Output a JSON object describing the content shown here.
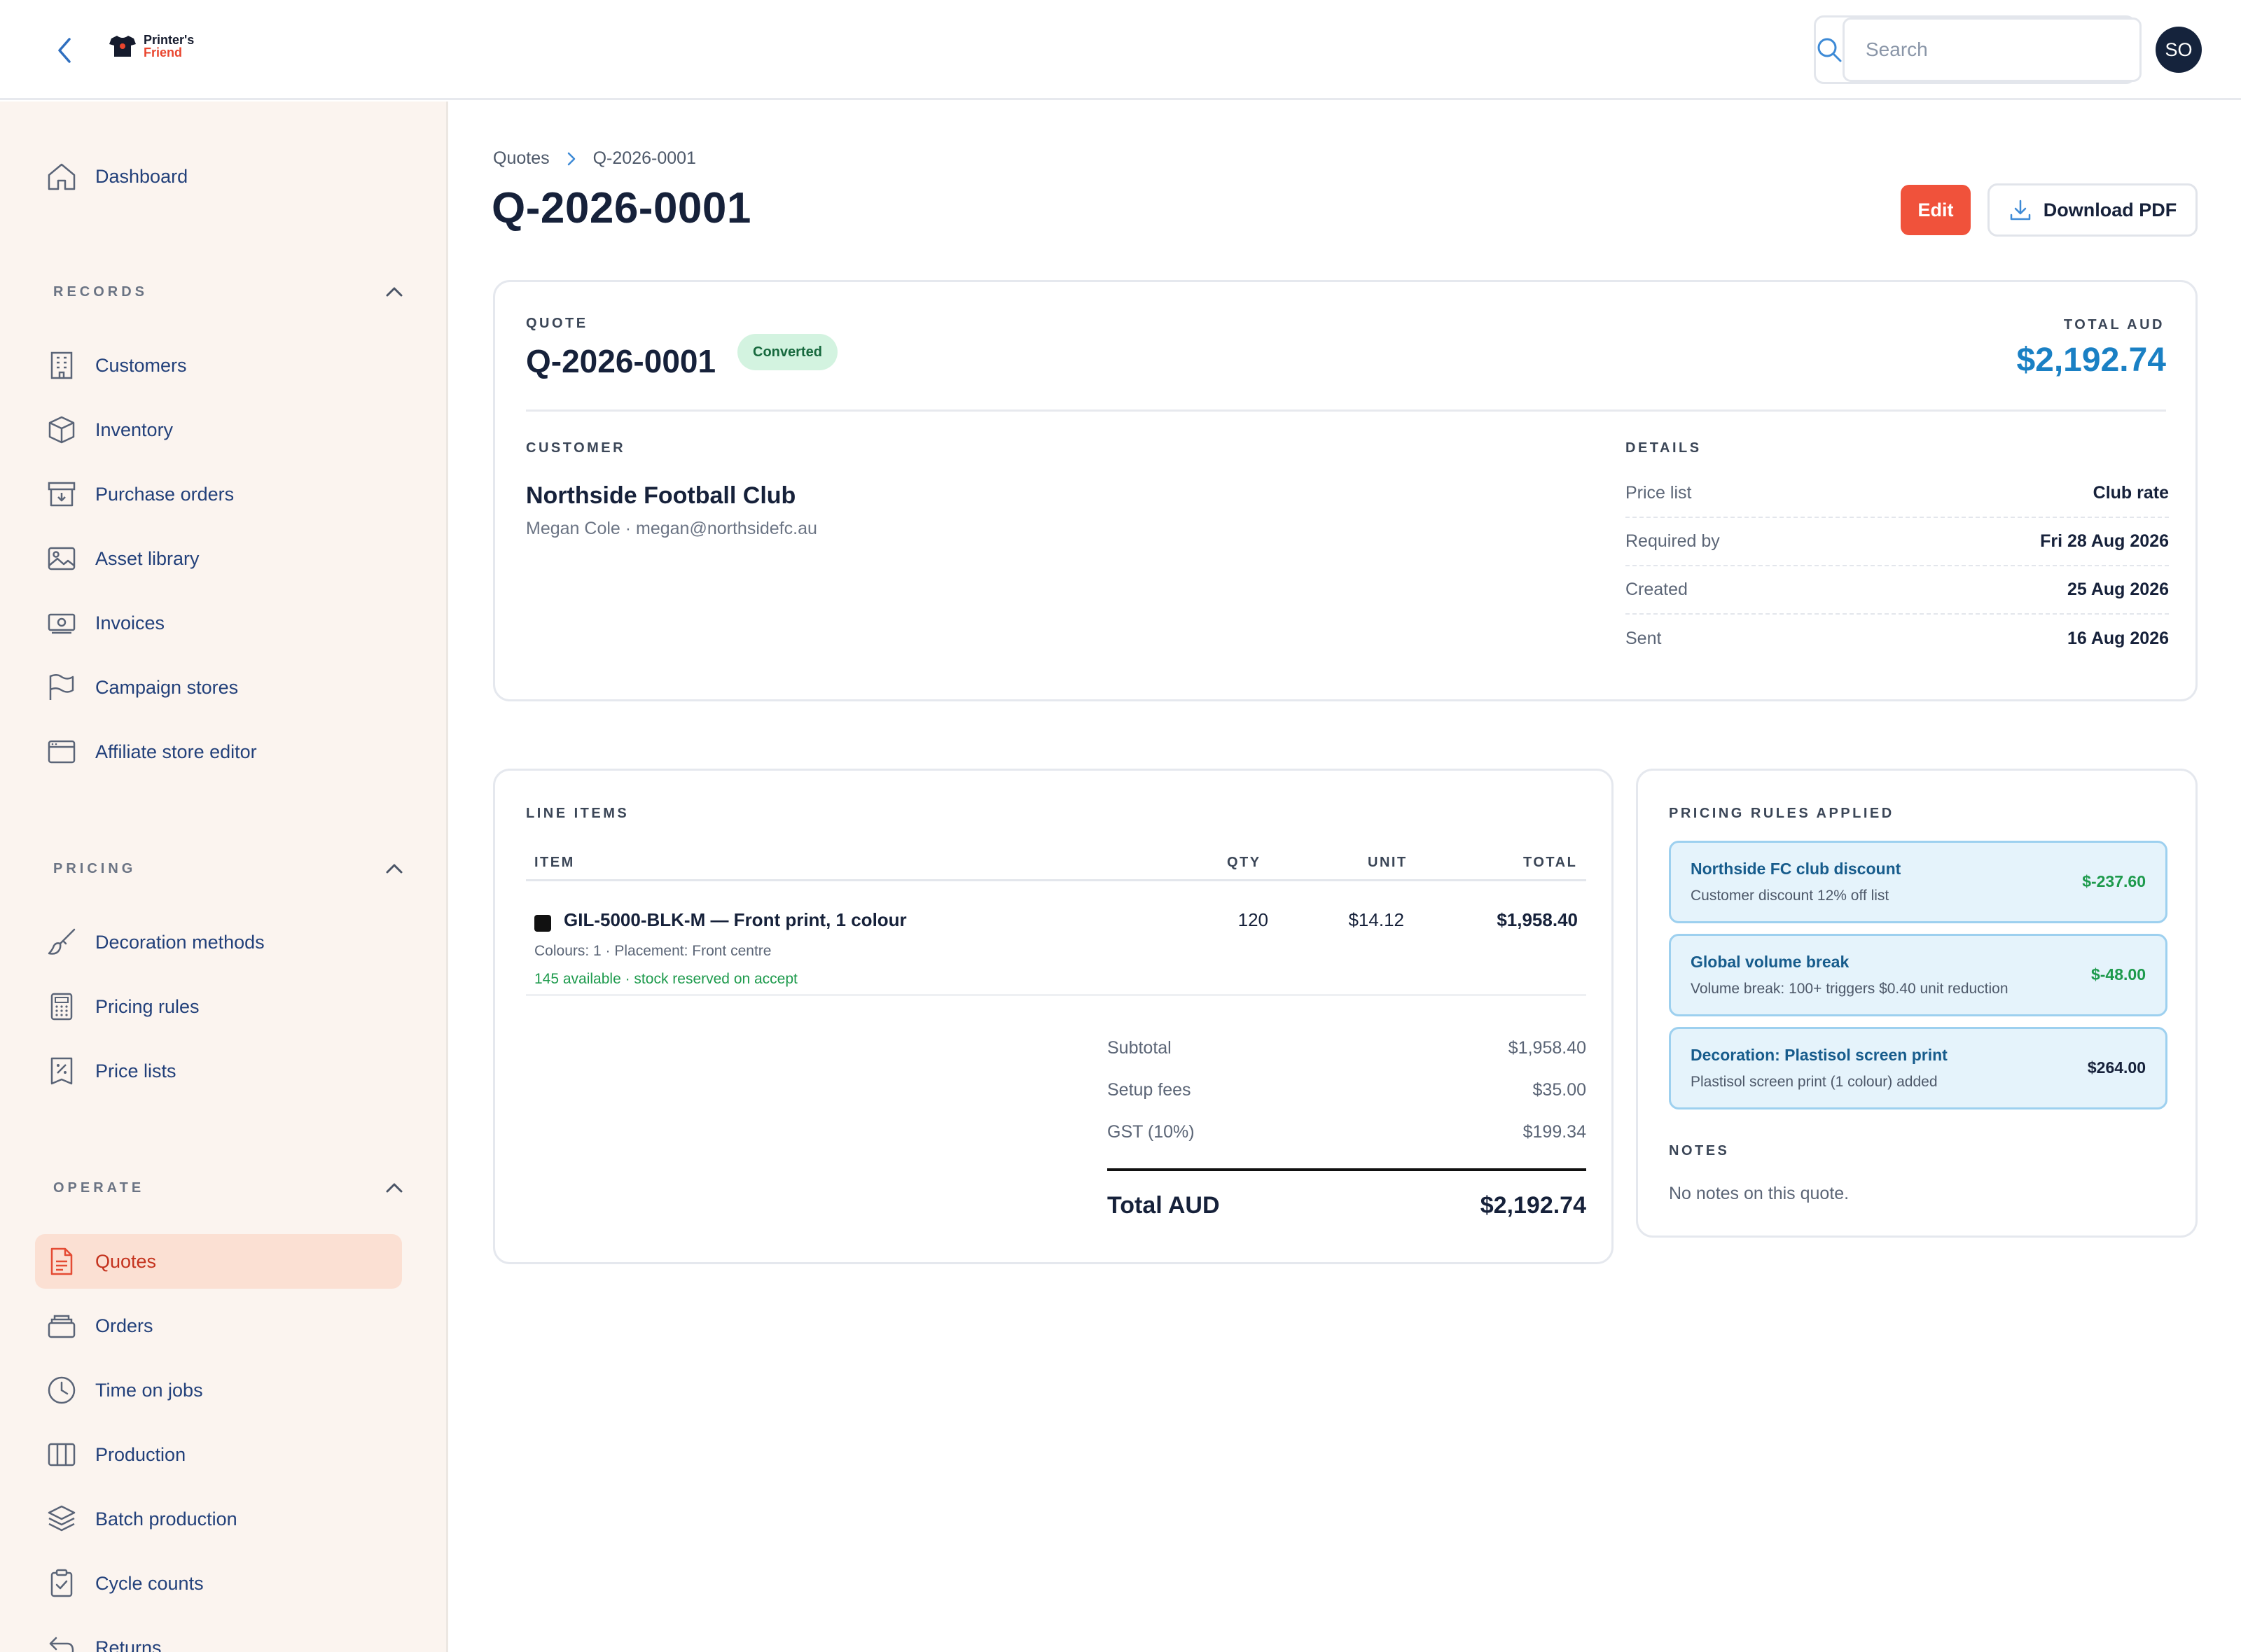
{
  "app": {
    "logo_line1": "Printer's",
    "logo_line2": "Friend",
    "search_placeholder": "Search",
    "avatar_initials": "SO",
    "accent_color": "#f0523b",
    "link_color": "#22407a"
  },
  "sidebar": {
    "dashboard": "Dashboard",
    "records": {
      "title": "RECORDS",
      "items": [
        "Customers",
        "Inventory",
        "Purchase orders",
        "Asset library",
        "Invoices",
        "Campaign stores",
        "Affiliate store editor"
      ]
    },
    "pricing": {
      "title": "PRICING",
      "items": [
        "Decoration methods",
        "Pricing rules",
        "Price lists"
      ]
    },
    "operate": {
      "title": "OPERATE",
      "items": [
        "Quotes",
        "Orders",
        "Time on jobs",
        "Production",
        "Batch production",
        "Cycle counts",
        "Returns"
      ],
      "active": "Quotes"
    }
  },
  "breadcrumb": {
    "parent": "Quotes",
    "current": "Q-2026-0001"
  },
  "page": {
    "title": "Q-2026-0001",
    "edit_label": "Edit",
    "download_label": "Download PDF"
  },
  "quote": {
    "label": "QUOTE",
    "number": "Q-2026-0001",
    "status": "Converted",
    "total_label": "TOTAL AUD",
    "total": "$2,192.74",
    "customer_label": "CUSTOMER",
    "customer_name": "Northside Football Club",
    "customer_contact": "Megan Cole · megan@northsidefc.au",
    "details_label": "DETAILS",
    "details": [
      {
        "k": "Price list",
        "v": "Club rate"
      },
      {
        "k": "Required by",
        "v": "Fri 28 Aug 2026"
      },
      {
        "k": "Created",
        "v": "25 Aug 2026"
      },
      {
        "k": "Sent",
        "v": "16 Aug 2026"
      }
    ]
  },
  "line_items": {
    "label": "LINE ITEMS",
    "columns": {
      "item": "ITEM",
      "qty": "QTY",
      "unit": "UNIT",
      "total": "TOTAL"
    },
    "rows": [
      {
        "name": "GIL-5000-BLK-M — Front print, 1 colour",
        "meta": "Colours: 1 · Placement: Front centre",
        "stock": "145 available · stock reserved on accept",
        "qty": "120",
        "unit": "$14.12",
        "total": "$1,958.40",
        "swatch_color": "#111111"
      }
    ],
    "summary": [
      {
        "k": "Subtotal",
        "v": "$1,958.40"
      },
      {
        "k": "Setup fees",
        "v": "$35.00"
      },
      {
        "k": "GST (10%)",
        "v": "$199.34"
      }
    ],
    "total_label": "Total AUD",
    "total_value": "$2,192.74"
  },
  "pricing_rules": {
    "label": "PRICING RULES APPLIED",
    "rules": [
      {
        "name": "Northside FC club discount",
        "desc": "Customer discount 12% off list",
        "amount": "$-237.60",
        "amount_color": "#1d9a4c"
      },
      {
        "name": "Global volume break",
        "desc": "Volume break: 100+ triggers $0.40 unit reduction",
        "amount": "$-48.00",
        "amount_color": "#1d9a4c"
      },
      {
        "name": "Decoration: Plastisol screen print",
        "desc": "Plastisol screen print (1 colour) added",
        "amount": "$264.00",
        "amount_color": "#16213a"
      }
    ],
    "notes_label": "NOTES",
    "notes_text": "No notes on this quote."
  }
}
